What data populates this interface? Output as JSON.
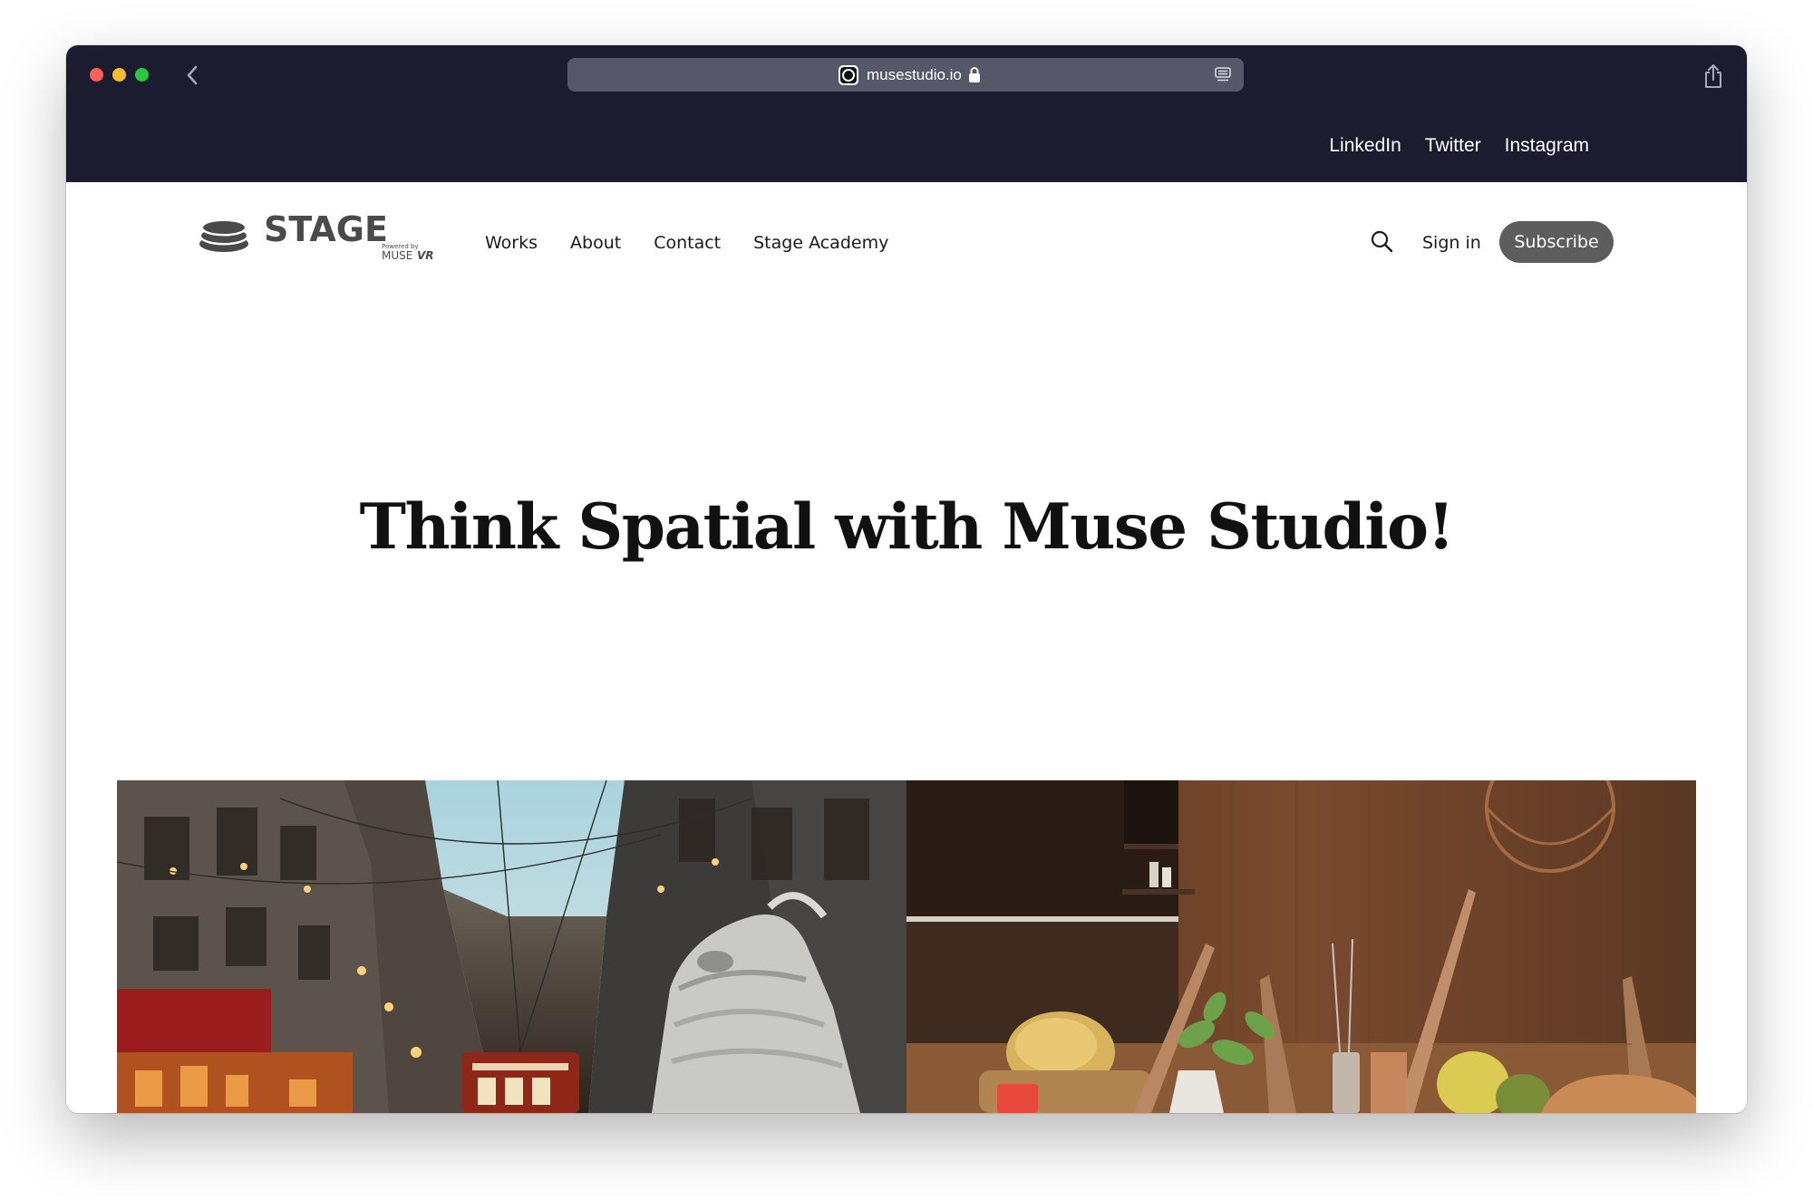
{
  "browser": {
    "url": "musestudio.io"
  },
  "top_bar": {
    "social_links": [
      {
        "label": "LinkedIn"
      },
      {
        "label": "Twitter"
      },
      {
        "label": "Instagram"
      }
    ]
  },
  "header": {
    "logo": {
      "wordmark": "STAGE",
      "tagline": "Powered by",
      "brand": "MUSE",
      "brand_suffix": "VR"
    },
    "nav": [
      {
        "label": "Works"
      },
      {
        "label": "About"
      },
      {
        "label": "Contact"
      },
      {
        "label": "Stage Academy"
      }
    ],
    "signin_label": "Sign in",
    "subscribe_label": "Subscribe"
  },
  "hero": {
    "title": "Think Spatial with Muse Studio!"
  },
  "gallery": {
    "items": [
      {
        "icon": "street-sneaker-image"
      },
      {
        "icon": "kitchen-knives-image"
      }
    ]
  },
  "colors": {
    "top_bar_bg": "#1b1c2f",
    "address_bar_bg": "#565869",
    "subscribe_bg": "#5d5d5d",
    "title_text": "#111111"
  }
}
